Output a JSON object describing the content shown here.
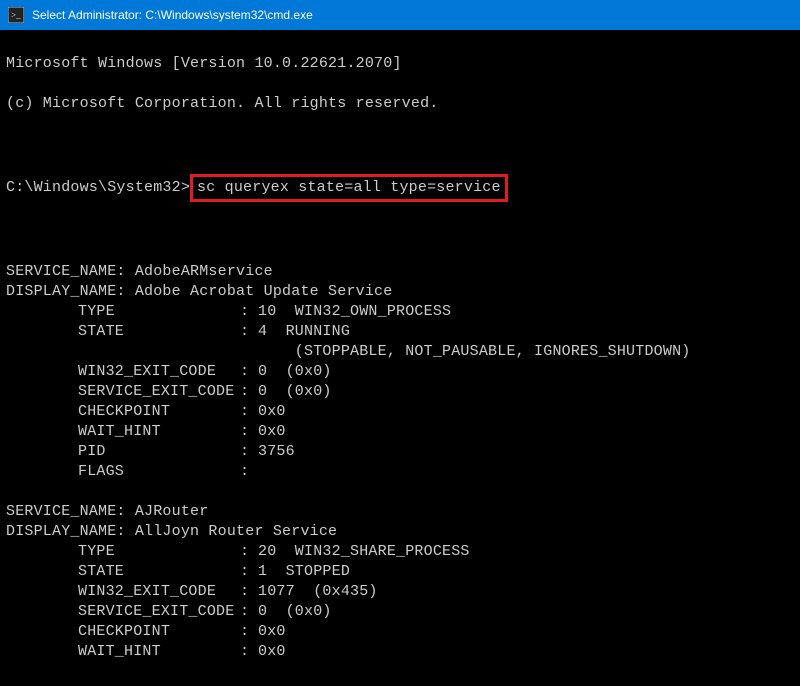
{
  "titlebar": {
    "title": "Select Administrator: C:\\Windows\\system32\\cmd.exe"
  },
  "header": {
    "line1": "Microsoft Windows [Version 10.0.22621.2070]",
    "line2": "(c) Microsoft Corporation. All rights reserved."
  },
  "prompt": {
    "path": "C:\\Windows\\System32>",
    "command": "sc queryex state=all type=service"
  },
  "services": [
    {
      "service_name": "AdobeARMservice",
      "display_name": "Adobe Acrobat Update Service",
      "fields": [
        {
          "label": "TYPE",
          "value": "10  WIN32_OWN_PROCESS"
        },
        {
          "label": "STATE",
          "value": "4  RUNNING"
        },
        {
          "label": "",
          "value": "    (STOPPABLE, NOT_PAUSABLE, IGNORES_SHUTDOWN)",
          "extended": true
        },
        {
          "label": "WIN32_EXIT_CODE",
          "value": "0  (0x0)"
        },
        {
          "label": "SERVICE_EXIT_CODE",
          "value": "0  (0x0)"
        },
        {
          "label": "CHECKPOINT",
          "value": "0x0"
        },
        {
          "label": "WAIT_HINT",
          "value": "0x0"
        },
        {
          "label": "PID",
          "value": "3756"
        },
        {
          "label": "FLAGS",
          "value": ""
        }
      ]
    },
    {
      "service_name": "AJRouter",
      "display_name": "AllJoyn Router Service",
      "fields": [
        {
          "label": "TYPE",
          "value": "20  WIN32_SHARE_PROCESS"
        },
        {
          "label": "STATE",
          "value": "1  STOPPED"
        },
        {
          "label": "WIN32_EXIT_CODE",
          "value": "1077  (0x435)"
        },
        {
          "label": "SERVICE_EXIT_CODE",
          "value": "0  (0x0)"
        },
        {
          "label": "CHECKPOINT",
          "value": "0x0"
        },
        {
          "label": "WAIT_HINT",
          "value": "0x0"
        }
      ]
    }
  ],
  "labels": {
    "service_name_prefix": "SERVICE_NAME: ",
    "display_name_prefix": "DISPLAY_NAME: "
  }
}
